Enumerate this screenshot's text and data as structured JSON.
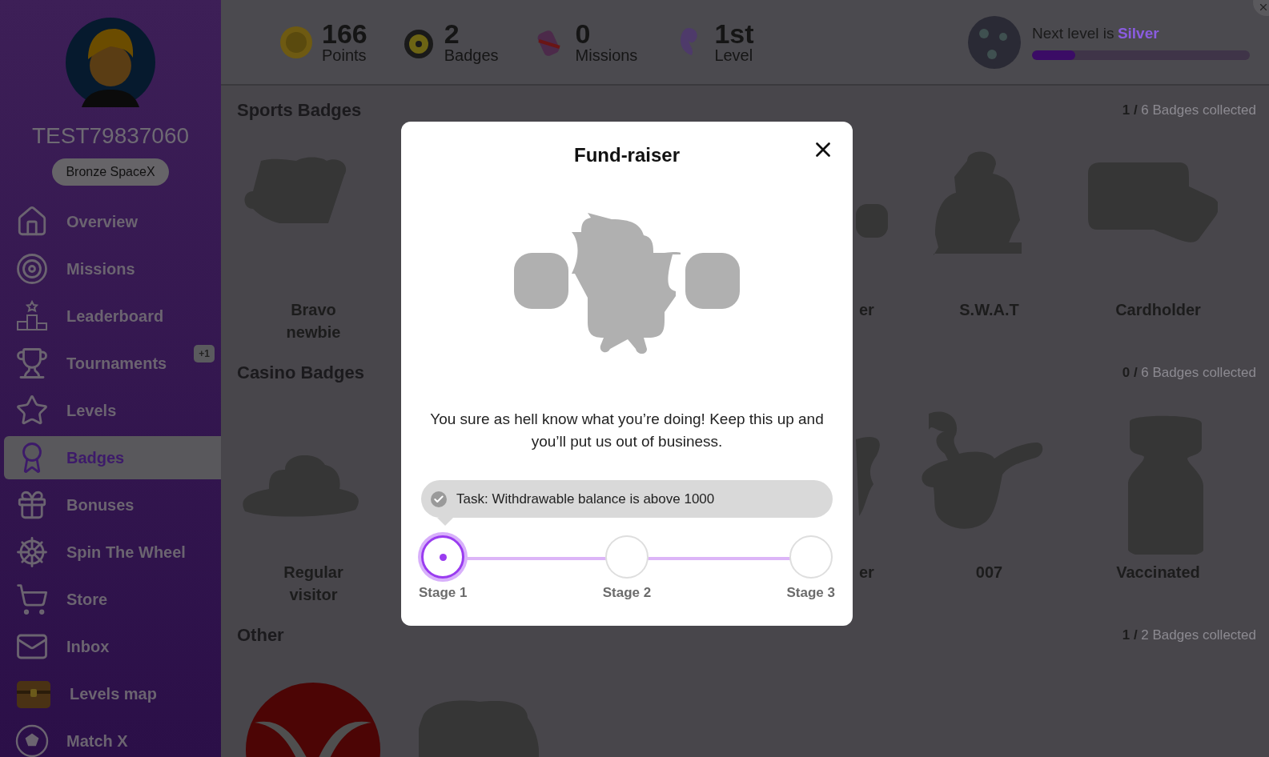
{
  "sidebar": {
    "username": "TEST79837060",
    "rank": "Bronze SpaceX",
    "items": [
      {
        "label": "Overview",
        "selected": false
      },
      {
        "label": "Missions",
        "selected": false
      },
      {
        "label": "Leaderboard",
        "selected": false
      },
      {
        "label": "Tournaments",
        "selected": false,
        "badge": "+1"
      },
      {
        "label": "Levels",
        "selected": false
      },
      {
        "label": "Badges",
        "selected": true
      },
      {
        "label": "Bonuses",
        "selected": false
      },
      {
        "label": "Spin The Wheel",
        "selected": false
      },
      {
        "label": "Store",
        "selected": false
      },
      {
        "label": "Inbox",
        "selected": false
      },
      {
        "label": "Levels map",
        "selected": false
      },
      {
        "label": "Match X",
        "selected": false
      }
    ]
  },
  "stats": [
    {
      "value": "166",
      "label": "Points"
    },
    {
      "value": "2",
      "label": "Badges"
    },
    {
      "value": "0",
      "label": "Missions"
    },
    {
      "value": "1st",
      "label": "Level"
    }
  ],
  "next_level": {
    "text": "Next level is",
    "level_name": "Silver",
    "level": 0.2
  },
  "sections": [
    {
      "title": "Sports Badges",
      "collected": "**1 /** 6 Badges collected",
      "badges": [
        {
          "kind": "hand",
          "label": "Bravo newbie"
        },
        {
          "kind": "blob-partial",
          "label": "er"
        },
        {
          "kind": "soldier",
          "label": "S.W.A.T"
        },
        {
          "kind": "card",
          "label": "Cardholder"
        }
      ]
    },
    {
      "title": "Casino Badges",
      "collected": "**0 /** 6 Badges collected",
      "badges": [
        {
          "kind": "cloud",
          "label": "Regular visitor"
        },
        {
          "kind": "bush-partial",
          "label": "er"
        },
        {
          "kind": "pipe",
          "label": "007"
        },
        {
          "kind": "vial",
          "label": "Vaccinated"
        }
      ]
    },
    {
      "title": "Other",
      "collected": "**1 /** 2 Badges collected",
      "badges": [
        {
          "kind": "emblem"
        },
        {
          "kind": "lump"
        }
      ]
    }
  ],
  "modal": {
    "title": "Fund-raiser",
    "description": "You sure as hell know what you’re doing! Keep this up and you’ll put us out of business.",
    "task": "Task: Withdrawable balance is above 1000",
    "task_done": true,
    "stages": [
      {
        "label": "Stage 1",
        "selected": true
      },
      {
        "label": "Stage 2",
        "selected": false
      },
      {
        "label": "Stage 3",
        "selected": false
      }
    ]
  }
}
